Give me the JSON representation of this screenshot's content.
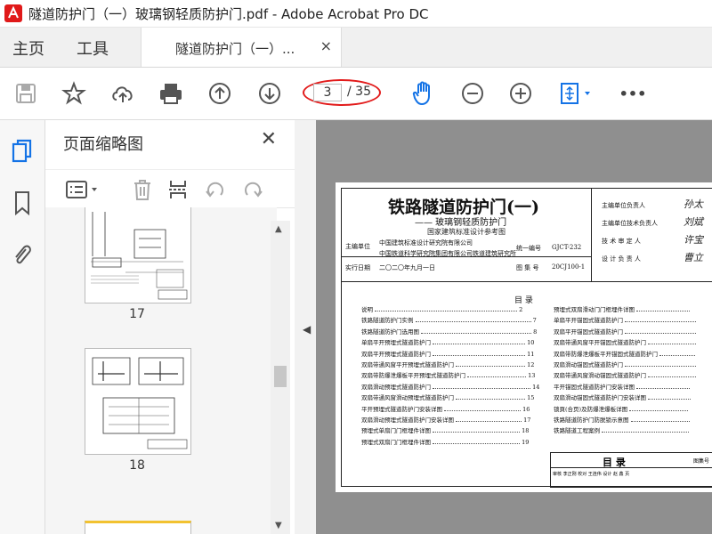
{
  "window": {
    "title": "隧道防护门（一）玻璃钢轻质防护门.pdf - Adobe Acrobat Pro DC",
    "logo_text": "Ai"
  },
  "tabs": {
    "home": "主页",
    "tools": "工具",
    "document": "隧道防护门（一）...",
    "close": "×"
  },
  "toolbar": {
    "page_current": "3",
    "page_total": "/ 35",
    "more": "•••"
  },
  "colors": {
    "accent": "#1473e6",
    "highlight_ring": "#e21b1b",
    "doc_bg": "#8f8f8f"
  },
  "panel": {
    "title": "页面缩略图",
    "close": "✕"
  },
  "thumbnails": [
    {
      "label": "17"
    },
    {
      "label": "18"
    }
  ],
  "document": {
    "title": "铁路隧道防护门(一)",
    "subtitle": "—— 玻璃钢轻质防护门",
    "category": "国家建筑标准设计参考图",
    "editor_unit_label": "主编单位",
    "editor_unit": "中国建筑标准设计研究院有限公司",
    "editor_unit2": "中国铁道科学研究院集团有限公司铁道建筑研究所",
    "date_label": "实行日期",
    "date": "二〇二〇年九月一日",
    "code_label": "统一编号",
    "code": "GJCT-232",
    "atlas_label": "图 集 号",
    "atlas": "20CJ100-1",
    "roles": [
      {
        "label": "主编单位负责人",
        "sig": "孙太"
      },
      {
        "label": "主编单位技术负责人",
        "sig": "刘斌"
      },
      {
        "label": "技 术 审 定 人",
        "sig": "许宝"
      },
      {
        "label": "设 计 负 责 人",
        "sig": "曹立"
      }
    ],
    "toc_title": "目    录",
    "toc_left": [
      {
        "t": "说明",
        "p": "2"
      },
      {
        "t": "铁路隧道防护门实例",
        "p": "7"
      },
      {
        "t": "铁路隧道防护门选用图",
        "p": "8"
      },
      {
        "t": "单扇平开预埋式隧道防护门",
        "p": "10"
      },
      {
        "t": "双扇平开预埋式隧道防护门",
        "p": "11"
      },
      {
        "t": "双扇带通风窗平开预埋式隧道防护门",
        "p": "12"
      },
      {
        "t": "双扇带防爆泄爆板平开预埋式隧道防护门",
        "p": "13"
      },
      {
        "t": "双扇滑动预埋式隧道防护门",
        "p": "14"
      },
      {
        "t": "双扇带通风窗滑动预埋式隧道防护门",
        "p": "15"
      },
      {
        "t": "平开预埋式隧道防护门安装详图",
        "p": "16"
      },
      {
        "t": "双扇滑动预埋式隧道防护门安装详图",
        "p": "17"
      },
      {
        "t": "预埋式单扇门门框埋件详图",
        "p": "18"
      },
      {
        "t": "预埋式双扇门门框埋件详图",
        "p": "19"
      }
    ],
    "toc_right": [
      {
        "t": "预埋式双扇滑动门门框埋件详图"
      },
      {
        "t": "单扇平开锚固式隧道防护门"
      },
      {
        "t": "双扇平开锚固式隧道防护门"
      },
      {
        "t": "双扇带通风窗平开锚固式隧道防护门"
      },
      {
        "t": "双扇带防爆泄爆板平开锚固式隧道防护门"
      },
      {
        "t": "双扇滑动锚固式隧道防护门"
      },
      {
        "t": "双扇带通风窗滑动锚固式隧道防护门"
      },
      {
        "t": "平开锚固式隧道防护门安装详图"
      },
      {
        "t": "双扇滑动锚固式隧道防护门安装详图"
      },
      {
        "t": "锁頁(合页)及防爆泄爆板详图"
      },
      {
        "t": "铁路隧道防护门防脱锁示意图"
      },
      {
        "t": "铁路隧道工程案例"
      }
    ],
    "footer_title": "目    录",
    "footer_atlas_label": "图集号",
    "footer_row": "审核 李正刚   校对 王连伟   设计 赵 鑫   页"
  }
}
